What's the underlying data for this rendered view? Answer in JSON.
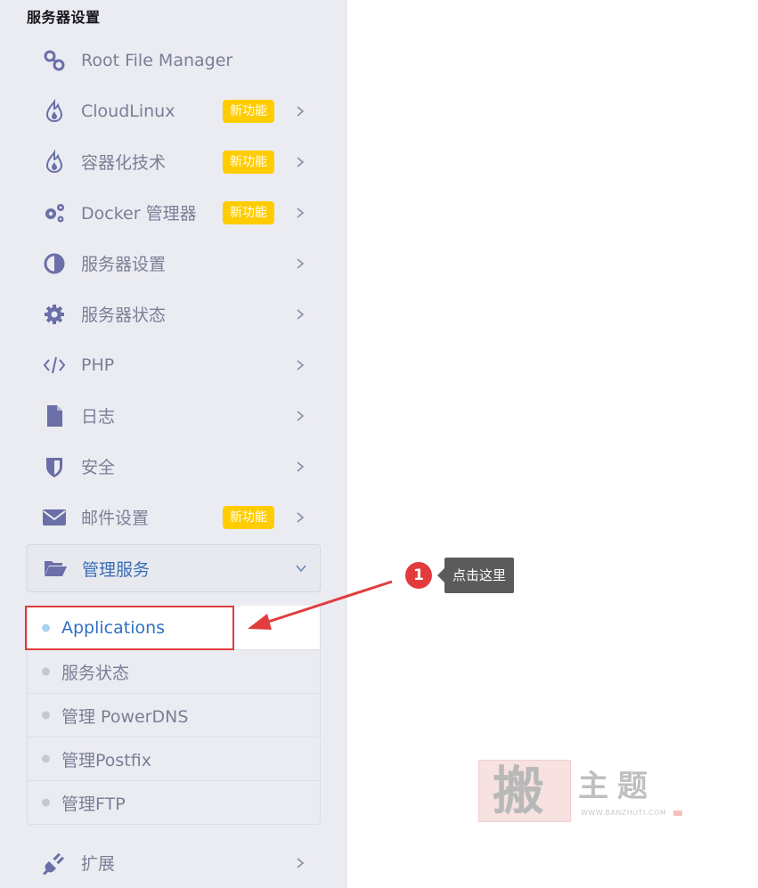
{
  "sidebar": {
    "section_title": "服务器设置",
    "items": [
      {
        "label": "Root File Manager",
        "icon": "link-icon",
        "badge": "",
        "chevron": false
      },
      {
        "label": "CloudLinux",
        "icon": "flame-icon",
        "badge": "新功能",
        "chevron": true
      },
      {
        "label": "容器化技术",
        "icon": "flame-icon",
        "badge": "新功能",
        "chevron": true
      },
      {
        "label": "Docker 管理器",
        "icon": "gears-icon",
        "badge": "新功能",
        "chevron": true
      },
      {
        "label": "服务器设置",
        "icon": "half-circle-icon",
        "badge": "",
        "chevron": true
      },
      {
        "label": "服务器状态",
        "icon": "gear-icon",
        "badge": "",
        "chevron": true
      },
      {
        "label": "PHP",
        "icon": "code-icon",
        "badge": "",
        "chevron": true
      },
      {
        "label": "日志",
        "icon": "file-icon",
        "badge": "",
        "chevron": true
      },
      {
        "label": "安全",
        "icon": "shield-icon",
        "badge": "",
        "chevron": true
      },
      {
        "label": "邮件设置",
        "icon": "envelope-icon",
        "badge": "新功能",
        "chevron": true
      }
    ],
    "open_item": {
      "label": "管理服务",
      "icon": "folder-open-icon"
    },
    "sub_items": [
      {
        "label": "Applications",
        "active": true
      },
      {
        "label": "服务状态",
        "active": false
      },
      {
        "label": "管理 PowerDNS",
        "active": false
      },
      {
        "label": "管理Postfix",
        "active": false
      },
      {
        "label": "管理FTP",
        "active": false
      }
    ],
    "extension_item": {
      "label": "扩展",
      "icon": "plug-icon"
    }
  },
  "annotation": {
    "step_number": "1",
    "tooltip": "点击这里"
  },
  "watermark": {
    "seal_char": "搬",
    "text": "主题",
    "url": "WWW.BANZHUTI.COM"
  },
  "colors": {
    "sidebar_bg": "#ebecf2",
    "badge": "#ffcc00",
    "active_link": "#2f71c4",
    "highlight": "#e23c3c",
    "icon": "#6a6fa8"
  }
}
